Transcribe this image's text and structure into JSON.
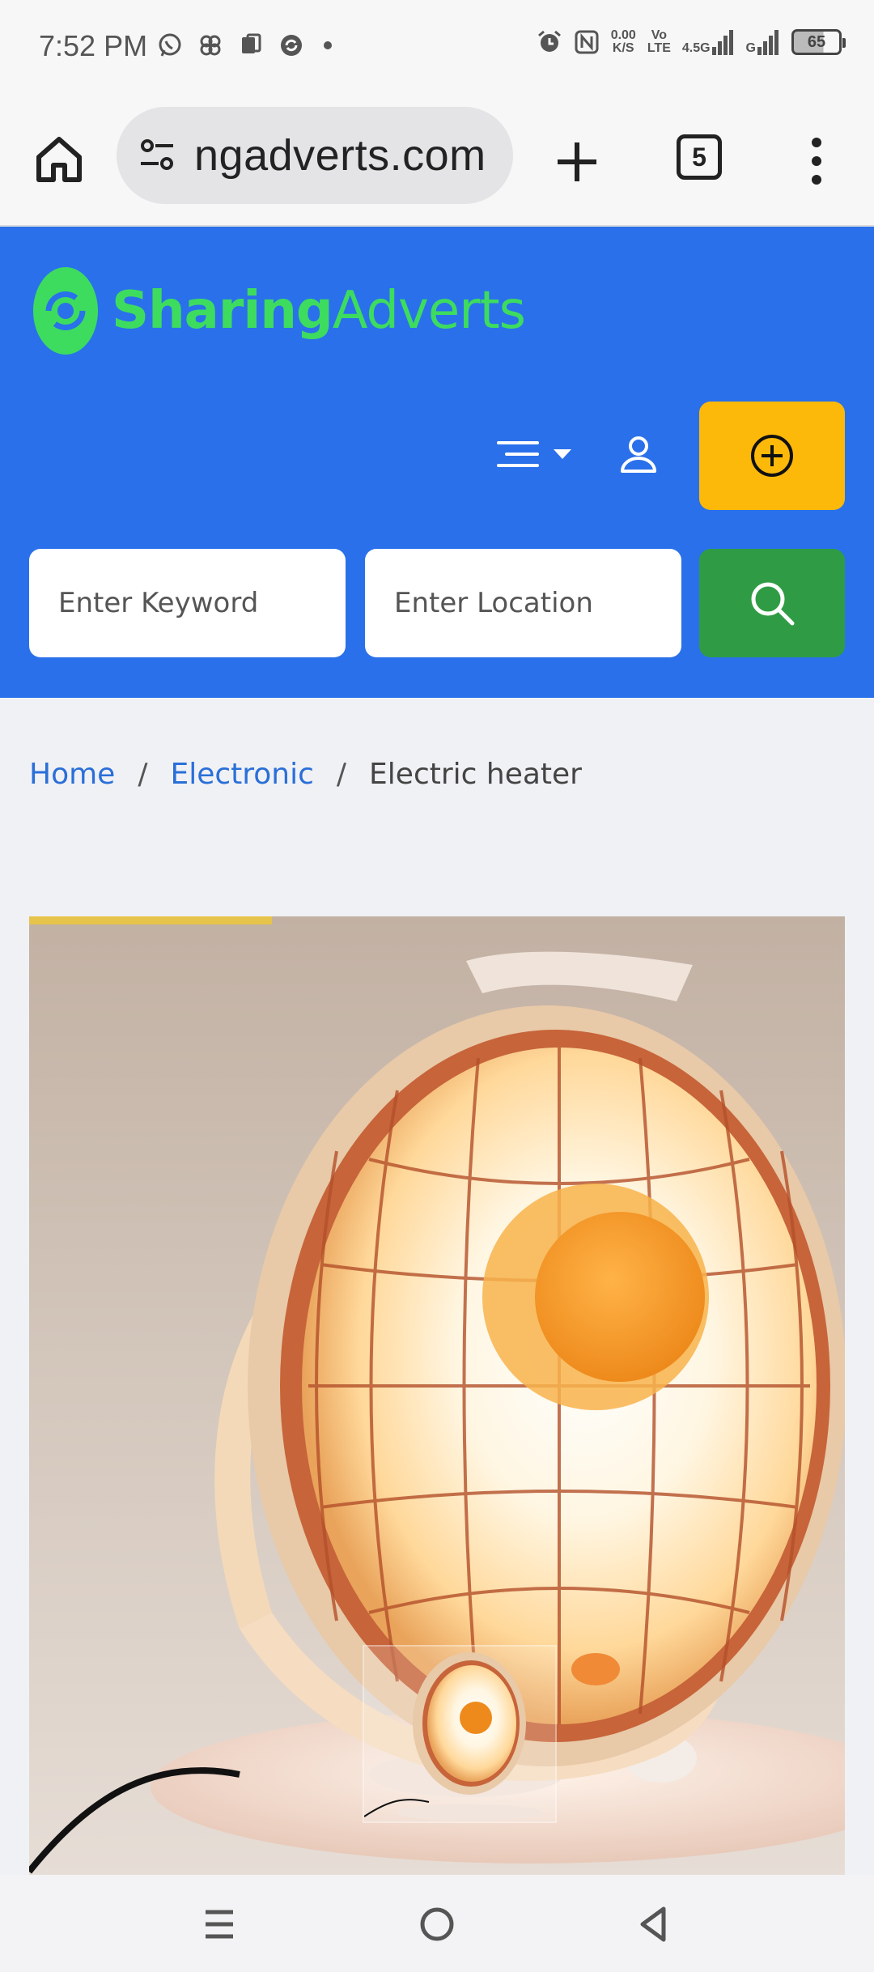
{
  "status_bar": {
    "time": "7:52 PM",
    "net_speed_value": "0.00",
    "net_speed_unit": "K/S",
    "volte_top": "Vo",
    "volte_bottom": "LTE",
    "network_type": "4.5G",
    "signal2_label": "G",
    "battery_level": "65"
  },
  "browser": {
    "url": "ngadverts.com",
    "tab_count": "5"
  },
  "site": {
    "logo_part1": "Sharing",
    "logo_part2": "Adverts",
    "colors": {
      "header": "#2a70ea",
      "post": "#fdb909",
      "search": "#2f9c45",
      "logo": "#3ddc5f"
    }
  },
  "search": {
    "keyword_placeholder": "Enter Keyword",
    "location_placeholder": "Enter Location"
  },
  "breadcrumb": {
    "home": "Home",
    "category": "Electronic",
    "current": "Electric heater",
    "separator": "/"
  }
}
